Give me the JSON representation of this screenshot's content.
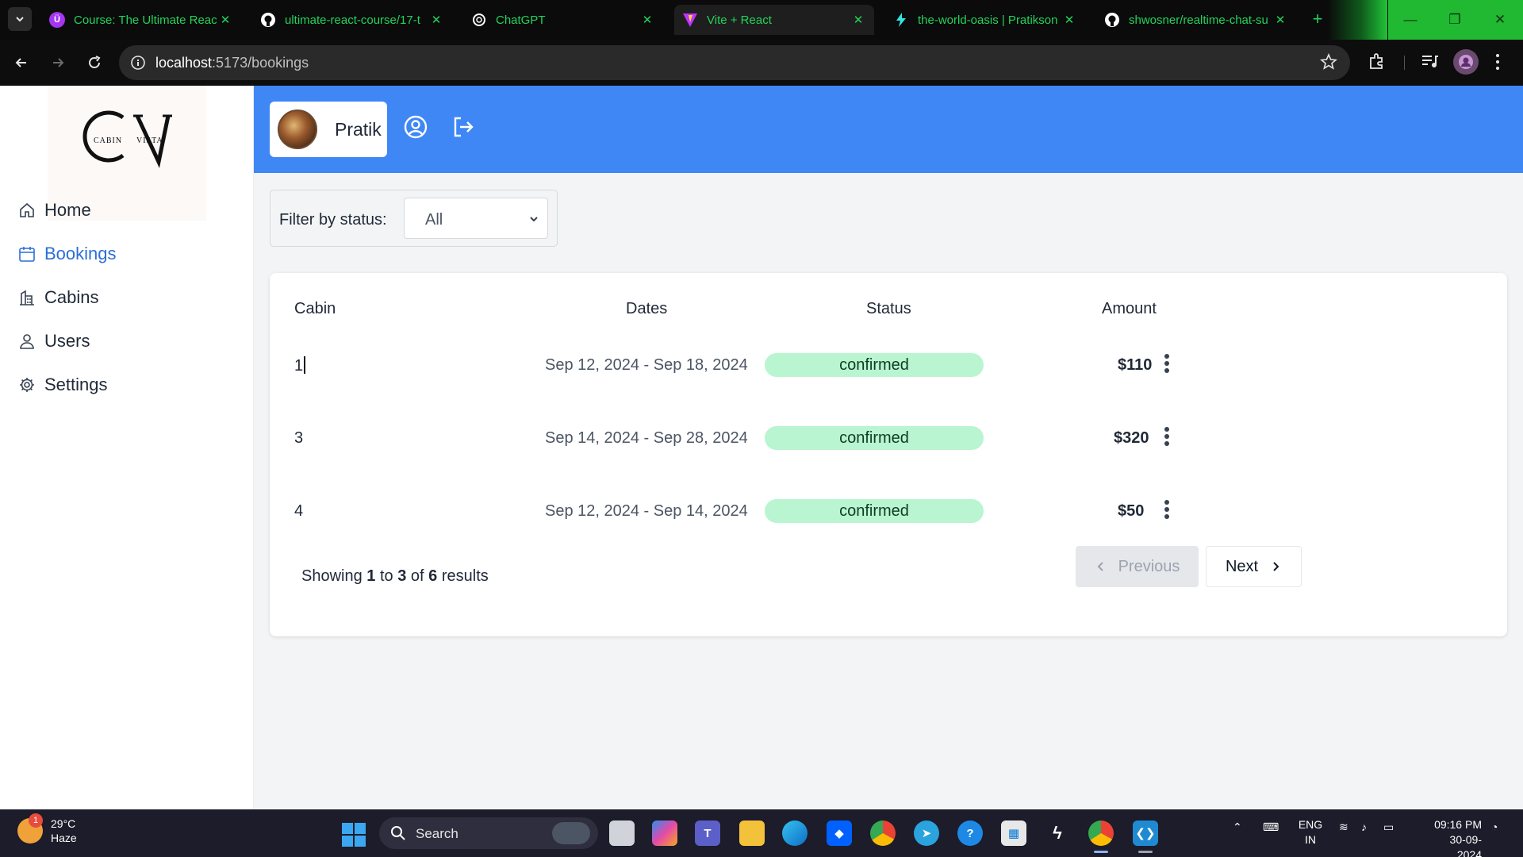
{
  "browser": {
    "tabs": [
      {
        "label": "Course: The Ultimate React",
        "icon": "udemy-icon",
        "color": "#a435f0"
      },
      {
        "label": "ultimate-react-course/17-t",
        "icon": "github-icon",
        "color": "#ffffff"
      },
      {
        "label": "ChatGPT",
        "icon": "openai-icon",
        "color": "#ffffff"
      },
      {
        "label": "Vite + React",
        "icon": "vite-icon",
        "color": "#bd34fe"
      },
      {
        "label": "the-world-oasis | Pratikson",
        "icon": "netlify-icon",
        "color": "#32e6e2"
      },
      {
        "label": "shwosner/realtime-chat-su",
        "icon": "github-icon",
        "color": "#ffffff"
      }
    ],
    "active_tab_index": 3,
    "url_host": "localhost",
    "url_path": ":5173/bookings",
    "accent_color": "#22d35a"
  },
  "sidebar": {
    "logo": {
      "initials": "CV",
      "left_word": "CABIN",
      "right_word": "VISTA"
    },
    "items": [
      {
        "label": "Home",
        "icon": "home-icon"
      },
      {
        "label": "Bookings",
        "icon": "calendar-icon",
        "active": true
      },
      {
        "label": "Cabins",
        "icon": "cabins-icon"
      },
      {
        "label": "Users",
        "icon": "user-icon"
      },
      {
        "label": "Settings",
        "icon": "gear-icon"
      }
    ],
    "active_color": "#2b6fd6"
  },
  "header": {
    "user_name": "Pratik",
    "background": "#3f87f5"
  },
  "filter": {
    "label": "Filter by status:",
    "selected": "All"
  },
  "table": {
    "columns": [
      "Cabin",
      "Dates",
      "Status",
      "Amount"
    ],
    "rows": [
      {
        "cabin": "1",
        "dates": "Sep 12, 2024 - Sep 18, 2024",
        "status": "confirmed",
        "amount": "$110"
      },
      {
        "cabin": "3",
        "dates": "Sep 14, 2024 - Sep 28, 2024",
        "status": "confirmed",
        "amount": "$320"
      },
      {
        "cabin": "4",
        "dates": "Sep 12, 2024 - Sep 14, 2024",
        "status": "confirmed",
        "amount": "$50"
      }
    ],
    "status_color": "#b9f5d0"
  },
  "pagination": {
    "prefix": "Showing",
    "from": "1",
    "to_word": "to",
    "to": "3",
    "of_word": "of",
    "total": "6",
    "suffix": "results",
    "previous_label": "Previous",
    "next_label": "Next"
  },
  "taskbar": {
    "weather_badge": "1",
    "temperature": "29°C",
    "condition": "Haze",
    "search_label": "Search",
    "language_top": "ENG",
    "language_bottom": "IN",
    "time": "09:16 PM",
    "date": "30-09-2024"
  }
}
